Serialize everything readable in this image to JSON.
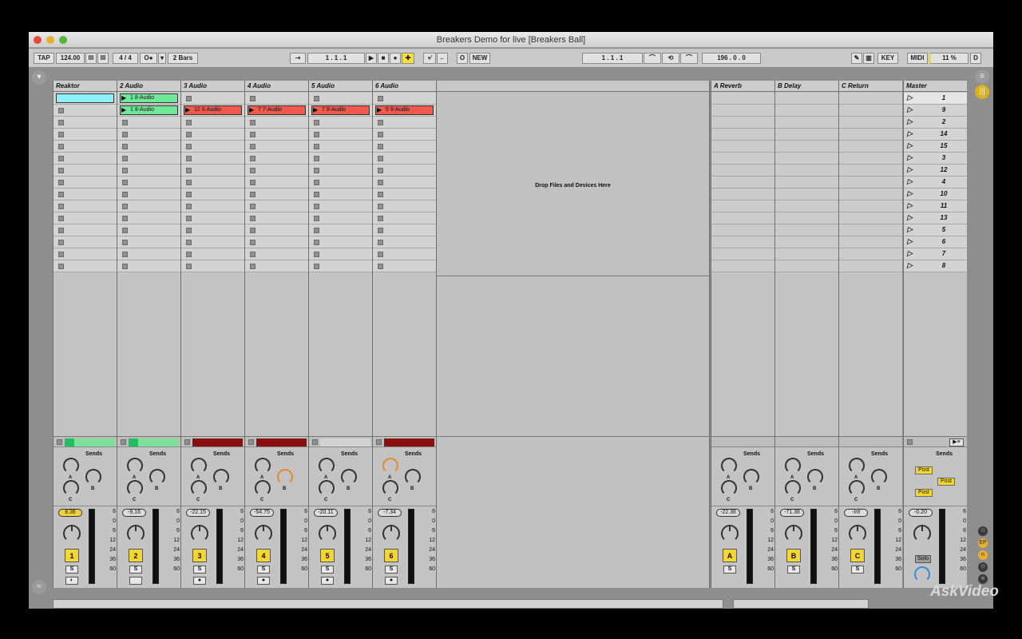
{
  "window": {
    "title": "Breakers Demo for live  [Breakers Ball]"
  },
  "toolbar": {
    "tap": "TAP",
    "tempo": "124.00",
    "nudge": "III",
    "nudge2": "III",
    "signature": "4 / 4",
    "metro": "O●",
    "quantize": "2 Bars",
    "follow": "⇢",
    "position": "1 .  1 .  1",
    "new": "NEW",
    "loop_start": "1 .  1 .  1",
    "loop_length": "196 .  0 .  0",
    "key": "KEY",
    "midi": "MIDI",
    "cpu": "11 %",
    "disk": "D"
  },
  "tracks": [
    {
      "name": "Reaktor",
      "volume": "8.36",
      "num": "1",
      "rec": "◐",
      "bar_color": "#7ddf9a",
      "bar_fill": "#20c060",
      "vol_hl": true,
      "knobA_orange": false,
      "knobB_orange": false,
      "clips": [
        {
          "row": 0,
          "text": "",
          "color": "#8ef0f8"
        }
      ]
    },
    {
      "name": "2 Audio",
      "volume": "-9.16",
      "num": "2",
      "rec": "",
      "bar_color": "#7ddf9a",
      "bar_fill": "#20c060",
      "vol_hl": false,
      "knobA_orange": false,
      "knobB_orange": false,
      "clips": [
        {
          "row": 0,
          "text": "1 8-Audio",
          "color": "#6ee898"
        },
        {
          "row": 1,
          "text": "1 8-Audio",
          "color": "#6ee898"
        }
      ]
    },
    {
      "name": "3 Audio",
      "volume": "-22.15",
      "num": "3",
      "rec": "●",
      "bar_color": "#8a1010",
      "bar_fill": "#8a1010",
      "vol_hl": false,
      "knobA_orange": false,
      "knobB_orange": false,
      "clips": [
        {
          "row": 1,
          "text": "12 6-Audio",
          "color": "#ef5a4a"
        }
      ]
    },
    {
      "name": "4 Audio",
      "volume": "-54.75",
      "num": "4",
      "rec": "●",
      "bar_color": "#8a1010",
      "bar_fill": "#8a1010",
      "vol_hl": false,
      "knobA_orange": false,
      "knobB_orange": true,
      "clips": [
        {
          "row": 1,
          "text": "7 7-Audio",
          "color": "#ef5a4a"
        }
      ]
    },
    {
      "name": "5 Audio",
      "volume": "-20.11",
      "num": "5",
      "rec": "●",
      "bar_color": "#d3d3d3",
      "bar_fill": "#d3d3d3",
      "vol_hl": false,
      "knobA_orange": false,
      "knobB_orange": false,
      "clips": [
        {
          "row": 1,
          "text": "7 8-Audio",
          "color": "#ef5a4a"
        }
      ]
    },
    {
      "name": "6 Audio",
      "volume": "-7.34",
      "num": "6",
      "rec": "●",
      "bar_color": "#8a1010",
      "bar_fill": "#8a1010",
      "vol_hl": false,
      "knobA_orange": true,
      "knobB_orange": false,
      "clips": [
        {
          "row": 1,
          "text": "5 9-Audio",
          "color": "#ef5a4a"
        }
      ]
    }
  ],
  "drop_text": "Drop Files and Devices Here",
  "returns": [
    {
      "name": "A Reverb",
      "volume": "-22.36",
      "num": "A"
    },
    {
      "name": "B Delay",
      "volume": "-71.36",
      "num": "B"
    },
    {
      "name": "C Return",
      "volume": "-Inf",
      "num": "C"
    }
  ],
  "master": {
    "name": "Master",
    "volume": "-0.20",
    "solo": "Solo",
    "post": "Post"
  },
  "scenes": [
    "1",
    "9",
    "2",
    "14",
    "15",
    "3",
    "12",
    "4",
    "10",
    "11",
    "13",
    "5",
    "6",
    "7",
    "8"
  ],
  "sends_label": "Sends",
  "solo_label": "S",
  "knob_labels": {
    "a": "A",
    "b": "B",
    "c": "C"
  },
  "scale": [
    "6",
    "0",
    "6",
    "12",
    "24",
    "36",
    "60"
  ],
  "watermark": "AskVideo"
}
